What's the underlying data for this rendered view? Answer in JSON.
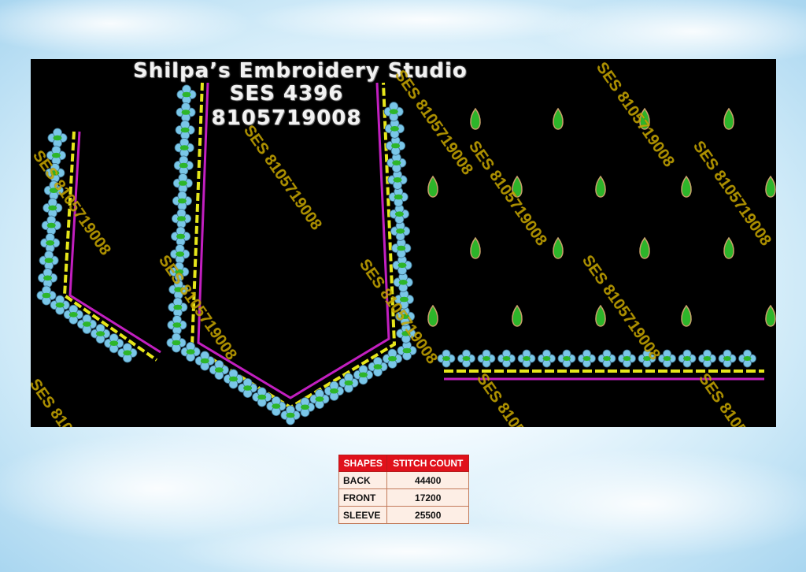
{
  "header": {
    "studio_name": "Shilpa’s Embroidery Studio",
    "design_code": "SES 4396",
    "phone": "8105719008"
  },
  "watermark": "SES 8105719008",
  "colors": {
    "background": "#000000",
    "border_magenta": "#c21fc0",
    "scallop_yellow": "#e6e61a",
    "leaf_green": "#2db52a",
    "flower_blue": "#7ac6e8",
    "table_header": "#e0111b",
    "table_row": "#fdeee5"
  },
  "table": {
    "headers": [
      "SHAPES",
      "STITCH COUNT"
    ],
    "rows": [
      {
        "shape": "BACK",
        "count": "44400"
      },
      {
        "shape": "FRONT",
        "count": "17200"
      },
      {
        "shape": "SLEEVE",
        "count": "25500"
      }
    ]
  }
}
